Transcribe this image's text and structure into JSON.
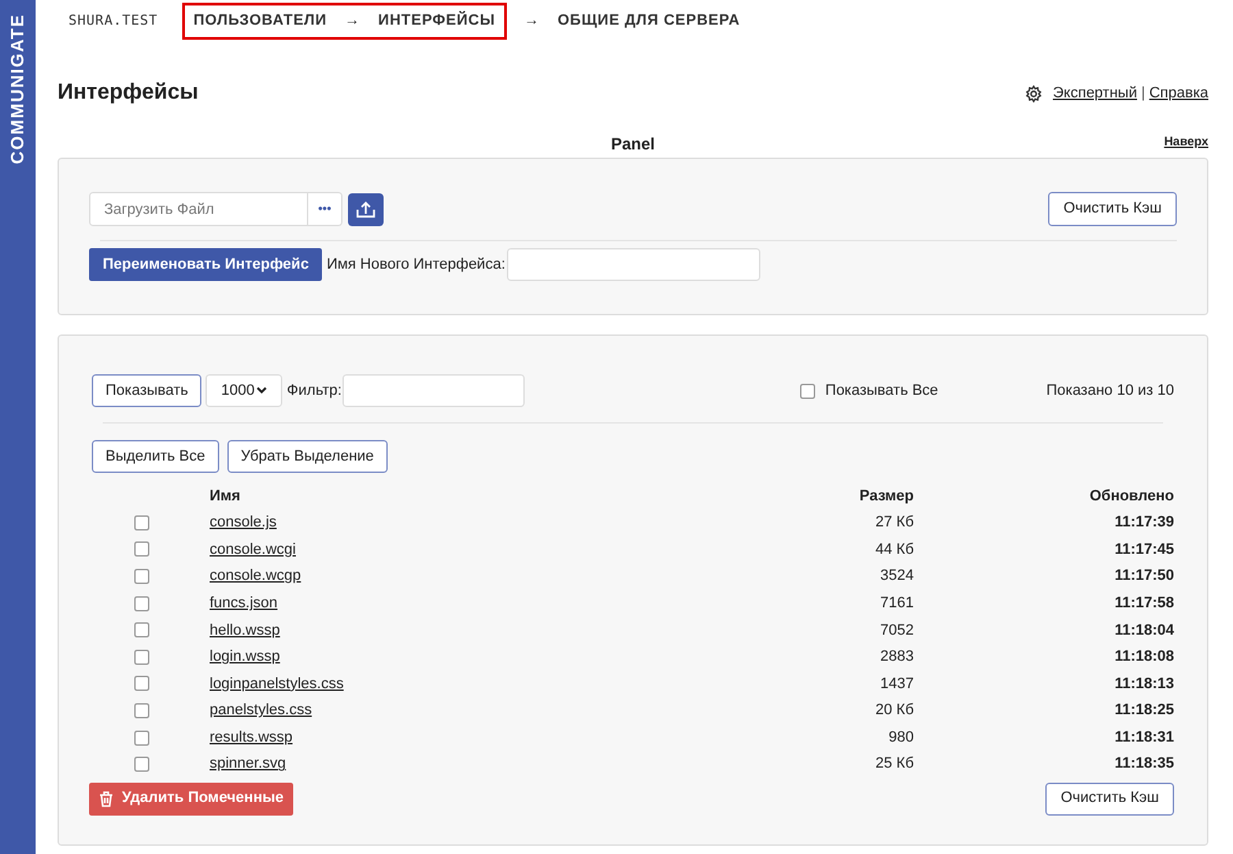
{
  "sidebar": {
    "logo": "COMMUNIGATE"
  },
  "breadcrumb": {
    "domain": "SHURA.TEST",
    "framed_items": [
      {
        "kind": "link",
        "text": "ПОЛЬЗОВАТЕЛИ"
      },
      {
        "kind": "separator",
        "text": "→"
      },
      {
        "kind": "link",
        "text": "ИНТЕРФЕЙСЫ"
      }
    ],
    "items": [
      {
        "kind": "separator",
        "text": "→"
      },
      {
        "kind": "link",
        "text": "ОБЩИЕ ДЛЯ СЕРВЕРА"
      }
    ]
  },
  "page": {
    "title": "Интерфейсы",
    "links": [
      "Экспертный",
      "Справка"
    ],
    "separator": "|"
  },
  "section": {
    "title": "Panel",
    "top_link": "Наверх"
  },
  "upload_panel": {
    "file_placeholder": "Загрузить Файл",
    "browse": "•••",
    "clear_cache": "Очистить Кэш",
    "rename_button": "Переименовать Интерфейс",
    "new_name_label": "Имя Нового Интерфейса:"
  },
  "list_panel": {
    "show_button": "Показывать",
    "page_size": "1000",
    "filter_label": "Фильтр:",
    "show_all": {
      "label": "Показывать Все",
      "checked": false
    },
    "count": "Показано 10 из 10",
    "select_all": "Выделить Все",
    "deselect": "Убрать Выделение",
    "columns": [
      "Имя",
      "Размер",
      "Обновлено"
    ],
    "rows": [
      {
        "checked": false,
        "name": "console.js",
        "size": "27 Кб",
        "updated": "11:17:39"
      },
      {
        "checked": false,
        "name": "console.wcgi",
        "size": "44 Кб",
        "updated": "11:17:45"
      },
      {
        "checked": false,
        "name": "console.wcgp",
        "size": "3524",
        "updated": "11:17:50"
      },
      {
        "checked": false,
        "name": "funcs.json",
        "size": "7161",
        "updated": "11:17:58"
      },
      {
        "checked": false,
        "name": "hello.wssp",
        "size": "7052",
        "updated": "11:18:04"
      },
      {
        "checked": false,
        "name": "login.wssp",
        "size": "2883",
        "updated": "11:18:08"
      },
      {
        "checked": false,
        "name": "loginpanelstyles.css",
        "size": "1437",
        "updated": "11:18:13"
      },
      {
        "checked": false,
        "name": "panelstyles.css",
        "size": "20 Кб",
        "updated": "11:18:25"
      },
      {
        "checked": false,
        "name": "results.wssp",
        "size": "980",
        "updated": "11:18:31"
      },
      {
        "checked": false,
        "name": "spinner.svg",
        "size": "25 Кб",
        "updated": "11:18:35"
      }
    ],
    "delete_button": "Удалить Помеченные",
    "clear_cache": "Очистить Кэш"
  }
}
